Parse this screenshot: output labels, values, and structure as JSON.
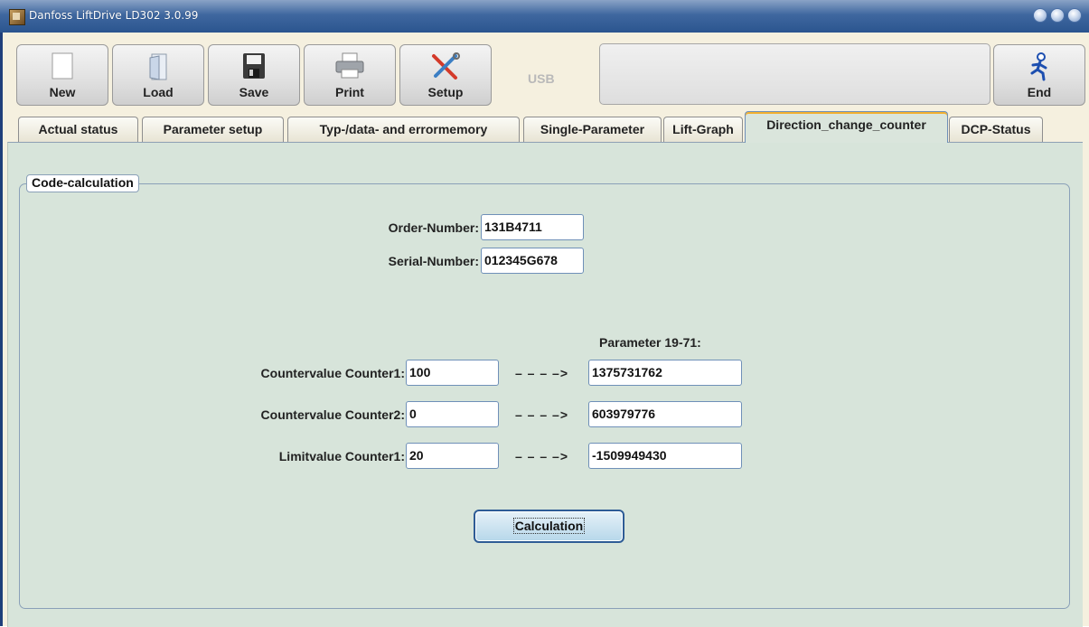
{
  "window": {
    "title": "Danfoss LiftDrive LD302  3.0.99"
  },
  "toolbar": {
    "new_label": "New",
    "load_label": "Load",
    "save_label": "Save",
    "print_label": "Print",
    "setup_label": "Setup",
    "connection_label": "USB",
    "end_label": "End"
  },
  "tabs": [
    {
      "label": "Actual status"
    },
    {
      "label": "Parameter setup"
    },
    {
      "label": "Typ-/data- and errormemory"
    },
    {
      "label": "Single-Parameter"
    },
    {
      "label": "Lift-Graph"
    },
    {
      "label": "Direction_change_counter",
      "active": true
    },
    {
      "label": "DCP-Status"
    }
  ],
  "group": {
    "title": "Code-calculation"
  },
  "order": {
    "label": "Order-Number:",
    "value": "131B4711"
  },
  "serial": {
    "label": "Serial-Number:",
    "value": "012345G678"
  },
  "parameter_header": "Parameter 19-71:",
  "counters": [
    {
      "label": "Countervalue Counter1:",
      "value": "100",
      "arrow": "– – – –>",
      "result": "1375731762"
    },
    {
      "label": "Countervalue Counter2:",
      "value": "0",
      "arrow": "– – – –>",
      "result": "603979776"
    },
    {
      "label": "Limitvalue Counter1:",
      "value": "20",
      "arrow": "– – – –>",
      "result": "-1509949430"
    }
  ],
  "calculation_button": "Calculation",
  "colors": {
    "titlebar": "#3f679f",
    "panel": "#d7e4da",
    "field_border": "#6f90b8",
    "active_tab_accent": "#f2b030"
  }
}
